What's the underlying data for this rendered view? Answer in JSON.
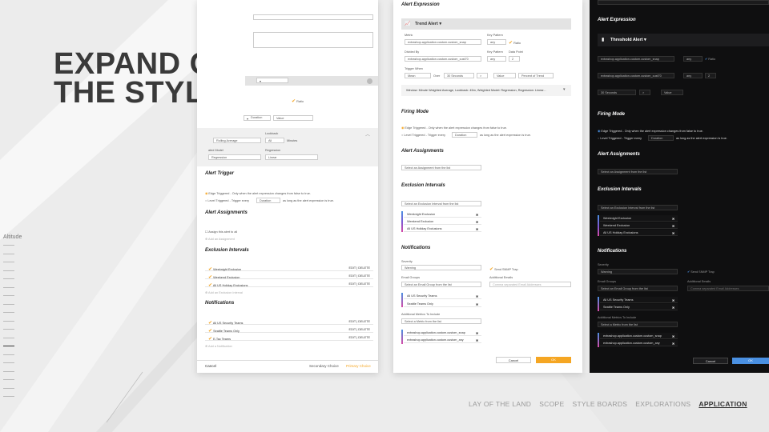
{
  "slide": {
    "headline_line1": "EXPAND ON",
    "headline_line2": "THE STYLE",
    "side_label": "Altitude"
  },
  "nav": {
    "items": [
      "LAY OF THE LAND",
      "SCOPE",
      "STYLE BOARDS",
      "EXPLORATIONS",
      "APPLICATION"
    ],
    "active": "APPLICATION"
  },
  "panel_left": {
    "ratio": "Ratio",
    "duration_placeholder": "Duration",
    "value_placeholder": "Value",
    "lookback_label": "Lookback",
    "rolling_average": "Rolling Average",
    "all": "All",
    "minutes": "Minutes",
    "trend_model_label": "ated Model",
    "regression_label": "Regression",
    "regression_value": "Regression",
    "linear_value": "Linear",
    "alert_trigger_title": "Alert Trigger",
    "edge_triggered": "Edge Triggered - Only when the alert expression changes from false to true.",
    "level_triggered": "Level Triggered - Trigger every",
    "level_triggered_suffix": "as long as the alert expression is true.",
    "duration": "Duration",
    "alert_assignments_title": "Alert Assignments",
    "assign_to_all": "Assign this alert to all",
    "add_assignment": "Add an Assignment",
    "exclusion_title": "Exclusion Intervals",
    "exclusions": [
      "Weeknight Exclusion",
      "Weekend Exclusion",
      "All US Holiday Exclusions"
    ],
    "add_exclusion": "Add an Exclusion Interval",
    "notifications_title": "Notifications",
    "notifications": [
      "All US Security Teams",
      "Seattle Teams Only",
      "E-Tac Teams"
    ],
    "add_notification": "Add a Notification",
    "edit_delete": "EDIT  |  DELETE",
    "cancel": "Cancel",
    "secondary": "Secondary Choice",
    "primary": "Primary Choice"
  },
  "panel_mid": {
    "alert_expression_title": "Alert Expression",
    "trend_alert": "Trend Alert",
    "metric_label": "Metric",
    "metric_value": "extrashop.application.custom.custom_snap",
    "key_pattern_label": "Key Pattern",
    "any": "any",
    "ratio": "Ratio",
    "divided_by_label": "Divided By",
    "divided_value": "extrashop.application.custom.custom_cust70",
    "data_point_label": "Data Point",
    "data_point_value": "2",
    "trigger_when_label": "Trigger When",
    "mean": "Mean",
    "over": "Over",
    "thirty_seconds": "30 Seconds",
    "gt": ">",
    "value": "Value",
    "percent_trend": "Percent of Trend",
    "window_text": "Window: Minute Weighted Average, Lookback: 45m, Weighted Model: Regression, Regression: Linear...",
    "firing_mode_title": "Firing Mode",
    "edge_triggered": "Edge Triggered - Only when the alert expression changes from false to true.",
    "level_triggered": "Level Triggered - Trigger every",
    "duration": "Duration",
    "level_suffix": "as long as the alert expression is true.",
    "alert_assignments_title": "Alert Assignments",
    "select_assignment": "Select an Assignment from the list",
    "exclusion_title": "Exclusion Intervals",
    "select_exclusion": "Select an Exclusion Interval from the list",
    "exclusions": [
      "Weeknight Exclusion",
      "Weekend Exclusion",
      "All US Holiday Exclusions"
    ],
    "notifications_title": "Notifications",
    "severity_label": "Severity",
    "severity_value": "Warning",
    "send_snmp": "Send SNMP Trap",
    "email_groups_label": "Email Groups",
    "select_email": "Select an Email Group from the list",
    "additional_emails_label": "Additional Emails",
    "additional_emails_placeholder": "Comma separated Email Addresses",
    "groups": [
      "All US Security Teams",
      "Seattle Teams Only"
    ],
    "additional_metrics_label": "Additional Metrics To Include",
    "select_metric": "Select a Metric from the list",
    "metrics": [
      "extrashop.application.custom.custom_snap",
      "extrashop.application.custom.custom_any"
    ],
    "cancel": "Cancel",
    "ok": "OK"
  },
  "panel_right": {
    "alert_expression_title": "Alert Expression",
    "threshold_alert": "Threshold Alert",
    "metric_value": "extrashop.application.custom.custom_snap",
    "any": "any",
    "ratio": "Ratio",
    "divided_value": "extrashop.application.custom.custom_cust70",
    "data_point_value": "2",
    "thirty_seconds": "30 Seconds",
    "gt": ">",
    "value": "Value",
    "firing_mode_title": "Firing Mode",
    "edge_triggered": "Edge Triggered - Only when the alert expression changes from false to true.",
    "level_triggered": "Level Triggered - Trigger every",
    "duration": "Duration",
    "level_suffix": "as long as the alert expression is true.",
    "alert_assignments_title": "Alert Assignments",
    "select_assignment": "Select an Assignment from the list",
    "exclusion_title": "Exclusion Intervals",
    "select_exclusion": "Select an Exclusion Interval from the list",
    "exclusions": [
      "Weeknight Exclusion",
      "Weekend Exclusion",
      "All US Holiday Exclusions"
    ],
    "notifications_title": "Notifications",
    "severity_label": "Severity",
    "severity_value": "Warning",
    "send_snmp": "Send SNMP Trap",
    "email_groups_label": "Email Groups",
    "additional_emails_label": "Additional Emails",
    "select_email": "Select an Email Group from the list",
    "additional_emails_placeholder": "Comma separated Email Addresses",
    "groups": [
      "All US Security Teams",
      "Seattle Teams Only"
    ],
    "additional_metrics_label": "Additional Metrics To Include",
    "select_metric": "Select a Metric from the list",
    "metrics": [
      "extrashop.application.custom.custom_snap",
      "extrashop.application.custom.custom_any"
    ],
    "cancel": "Cancel",
    "ok": "OK"
  }
}
